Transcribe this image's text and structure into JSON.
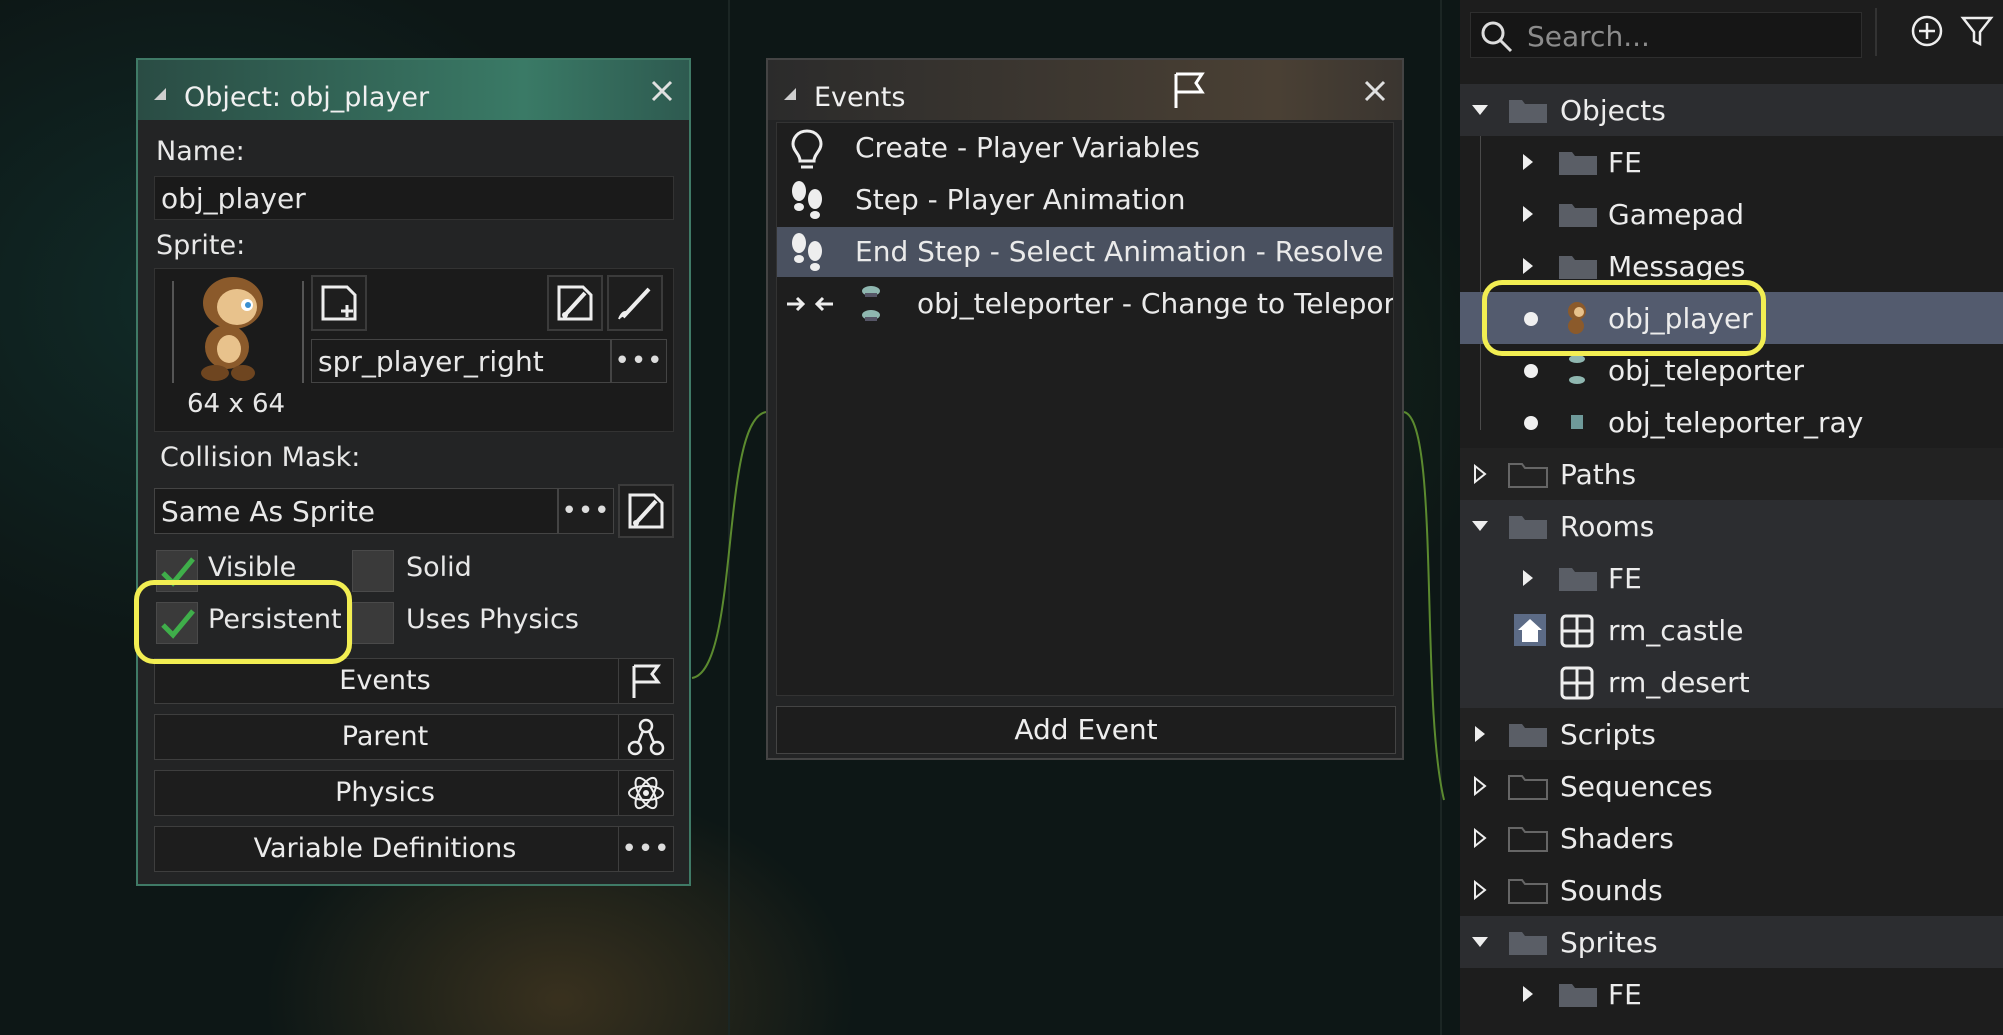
{
  "object_editor": {
    "title": "Object: obj_player",
    "name_label": "Name:",
    "name_value": "obj_player",
    "sprite_label": "Sprite:",
    "sprite_name": "spr_player_right",
    "sprite_size": "64 x 64",
    "collision_label": "Collision Mask:",
    "collision_value": "Same As Sprite",
    "checkboxes": {
      "visible": {
        "label": "Visible",
        "checked": true
      },
      "solid": {
        "label": "Solid",
        "checked": false
      },
      "persistent": {
        "label": "Persistent",
        "checked": true
      },
      "uses_physics": {
        "label": "Uses Physics",
        "checked": false
      }
    },
    "buttons": {
      "events": "Events",
      "parent": "Parent",
      "physics": "Physics",
      "variable_definitions": "Variable Definitions"
    }
  },
  "events_editor": {
    "title": "Events",
    "events": [
      {
        "label": "Create - Player Variables",
        "icon": "lightbulb-icon",
        "selected": false
      },
      {
        "label": "Step - Player Animation",
        "icon": "footsteps-icon",
        "selected": false
      },
      {
        "label": "End Step - Select Animation - Resolve Colli",
        "icon": "footsteps-icon",
        "selected": true
      },
      {
        "label": "obj_teleporter - Change to Teleporter",
        "icon": "collision-icon",
        "selected": false
      }
    ],
    "add_event": "Add Event"
  },
  "asset_browser": {
    "search_placeholder": "Search...",
    "tree": {
      "objects": "Objects",
      "fe": "FE",
      "gamepad": "Gamepad",
      "messages": "Messages",
      "obj_player": "obj_player",
      "obj_teleporter": "obj_teleporter",
      "obj_teleporter_ray": "obj_teleporter_ray",
      "paths": "Paths",
      "rooms": "Rooms",
      "rooms_fe": "FE",
      "rm_castle": "rm_castle",
      "rm_desert": "rm_desert",
      "scripts": "Scripts",
      "sequences": "Sequences",
      "shaders": "Shaders",
      "sounds": "Sounds",
      "sprites": "Sprites",
      "sprites_fe": "FE"
    }
  },
  "colors": {
    "highlight": "#f2ee52",
    "selection": "#535b6e",
    "check_green": "#3fae4a"
  }
}
